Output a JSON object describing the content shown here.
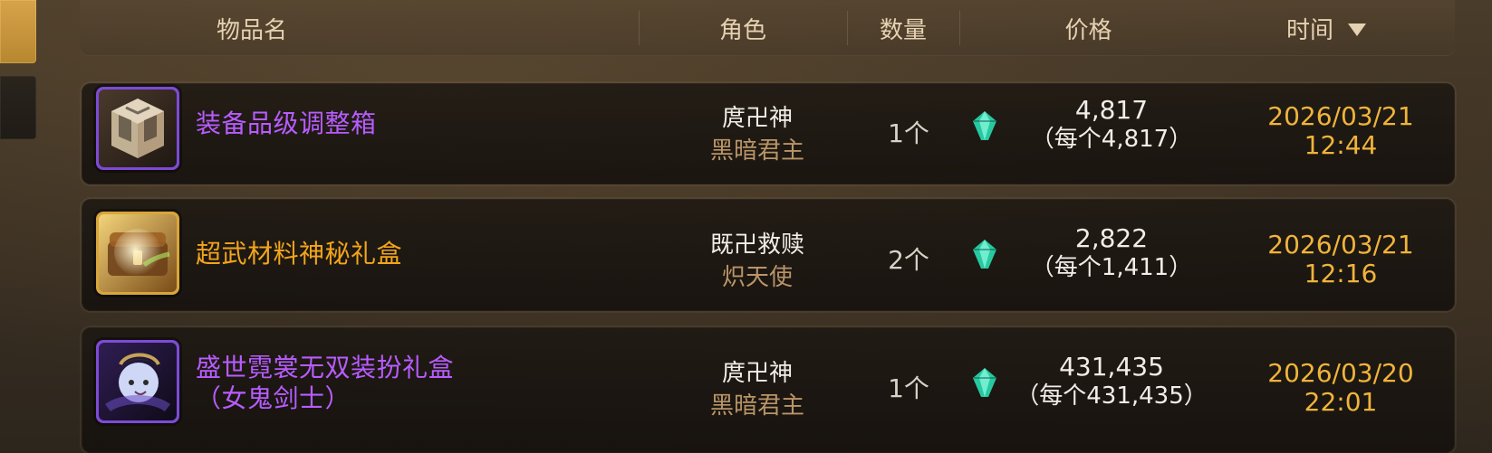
{
  "header": {
    "item": "物品名",
    "role": "角色",
    "qty": "数量",
    "price": "价格",
    "time": "时间"
  },
  "rows": [
    {
      "name_line1": "装备品级调整箱",
      "name_line2": "",
      "name_color": "#b85cff",
      "role_name": "庹卍神",
      "role_class": "黑暗君主",
      "qty": "1个",
      "price": "4,817",
      "price_per": "（每个4,817）",
      "time_date": "2026/03/21",
      "time_clock": "12:44",
      "icon": "cube-box-icon",
      "icon_border": "#7d4bd6"
    },
    {
      "name_line1": "超武材料神秘礼盒",
      "name_line2": "",
      "name_color": "#f2a51c",
      "role_name": "既卍救赎",
      "role_class": "炽天使",
      "qty": "2个",
      "price": "2,822",
      "price_per": "（每个1,411）",
      "time_date": "2026/03/21",
      "time_clock": "12:16",
      "icon": "treasure-chest-icon",
      "icon_border": "#d9a63a"
    },
    {
      "name_line1": "盛世霓裳无双装扮礼盒",
      "name_line2": "（女鬼剑士）",
      "name_color": "#b85cff",
      "role_name": "庹卍神",
      "role_class": "黑暗君主",
      "qty": "1个",
      "price": "431,435",
      "price_per": "（每个431,435）",
      "time_date": "2026/03/20",
      "time_clock": "22:01",
      "icon": "character-portrait-icon",
      "icon_border": "#7d4bd6"
    }
  ],
  "colors": {
    "rare_purple": "#b85cff",
    "epic_orange": "#f2a51c",
    "time_gold": "#f0b43a",
    "header_text": "#e6d1b2",
    "gem_teal": "#2de0b3"
  }
}
